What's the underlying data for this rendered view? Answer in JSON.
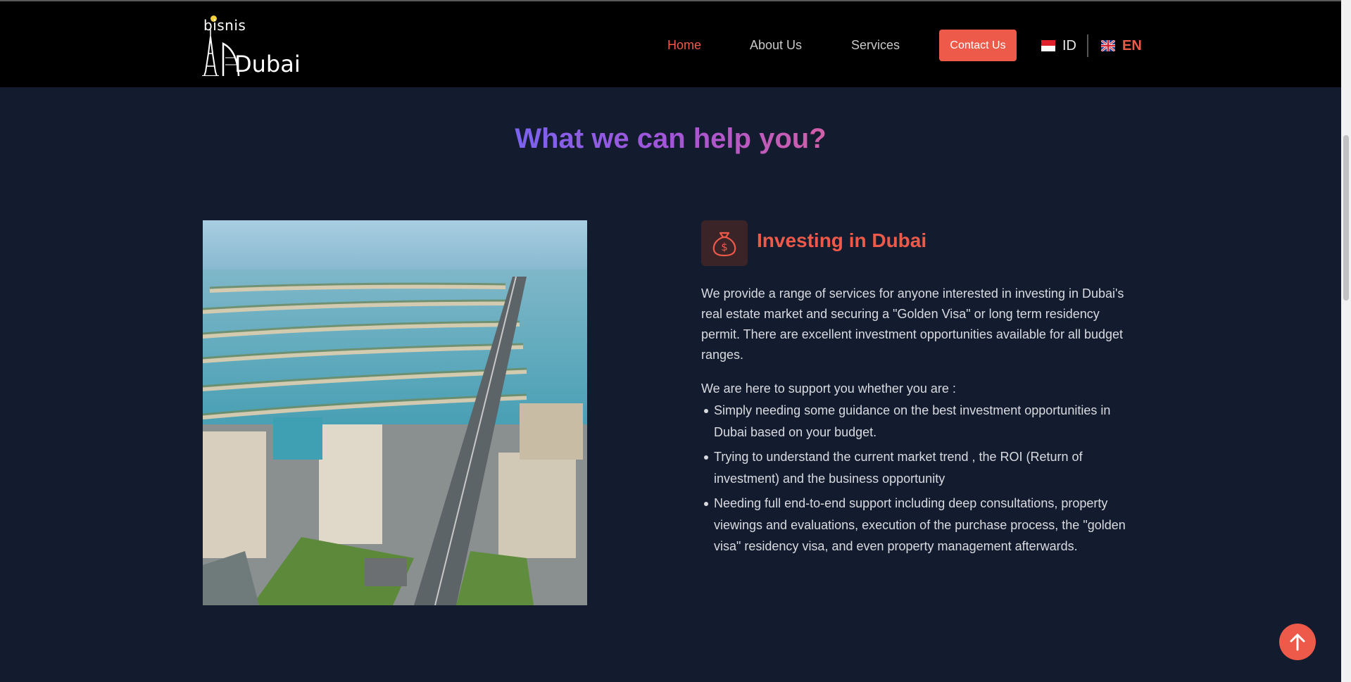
{
  "header": {
    "logo": {
      "top": "bisnis",
      "bottom": "Dubai",
      "dot_color": "#f4d03f"
    },
    "nav": [
      {
        "label": "Home",
        "active": true
      },
      {
        "label": "About Us",
        "active": false
      },
      {
        "label": "Services",
        "active": false
      }
    ],
    "contact_label": "Contact Us",
    "languages": [
      {
        "code": "ID",
        "active": false,
        "flag": "indonesia-flag-icon"
      },
      {
        "code": "EN",
        "active": true,
        "flag": "uk-flag-icon"
      }
    ]
  },
  "section": {
    "title": "What we can help you?"
  },
  "service": {
    "icon": "money-bag-icon",
    "title": "Investing in Dubai",
    "description": "We provide a range of services for anyone interested in investing in Dubai's real estate market and securing a \"Golden Visa\" or long term residency permit. There are excellent investment opportunities available for all budget ranges.",
    "support_lead": "We are here to support you whether you are :",
    "bullets": [
      "Simply needing some guidance on the best investment opportunities in Dubai based on your budget.",
      "Trying to understand the current market trend , the ROI (Return of investment) and the business opportunity",
      "Needing full end-to-end support including deep consultations, property viewings and evaluations, execution of the purchase process, the \"golden visa\" residency visa, and even property management afterwards."
    ]
  },
  "colors": {
    "accent": "#ee5a4a",
    "background": "#131b2e",
    "header": "#000000",
    "title_gradient": [
      "#7b63ee",
      "#d25fa8"
    ]
  },
  "back_to_top_icon": "arrow-up-icon"
}
